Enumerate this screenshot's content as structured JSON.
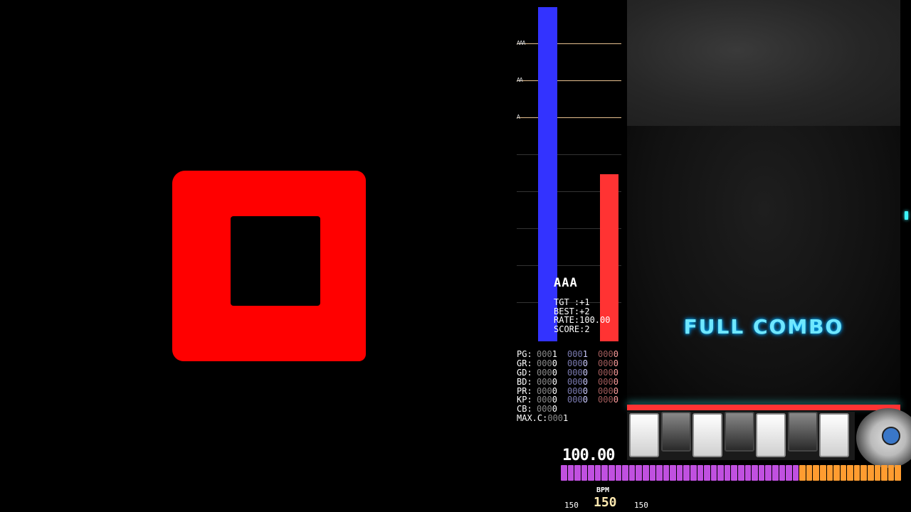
{
  "graph": {
    "grade_marks": [
      "AAA",
      "AA",
      "A"
    ],
    "current_fraction": 1.0,
    "target_fraction": 0.5
  },
  "rank": "AAA",
  "stats": {
    "tgt": "TGT :+1",
    "best": "BEST:+2",
    "rate": "RATE:100.00",
    "score": "SCORE:2"
  },
  "judge": [
    {
      "label": "PG:",
      "total": [
        "000",
        "1"
      ],
      "slow": [
        "000",
        "1"
      ],
      "fast": [
        "000",
        "0"
      ]
    },
    {
      "label": "GR:",
      "total": [
        "000",
        "0"
      ],
      "slow": [
        "000",
        "0"
      ],
      "fast": [
        "000",
        "0"
      ]
    },
    {
      "label": "GD:",
      "total": [
        "000",
        "0"
      ],
      "slow": [
        "000",
        "0"
      ],
      "fast": [
        "000",
        "0"
      ]
    },
    {
      "label": "BD:",
      "total": [
        "000",
        "0"
      ],
      "slow": [
        "000",
        "0"
      ],
      "fast": [
        "000",
        "0"
      ]
    },
    {
      "label": "PR:",
      "total": [
        "000",
        "0"
      ],
      "slow": [
        "000",
        "0"
      ],
      "fast": [
        "000",
        "0"
      ]
    },
    {
      "label": "KP:",
      "total": [
        "000",
        "0"
      ],
      "slow": [
        "000",
        "0"
      ],
      "fast": [
        "000",
        "0"
      ]
    },
    {
      "label": "CB:",
      "total": [
        "000",
        "0"
      ]
    }
  ],
  "max_combo": {
    "label": "MAX.C:",
    "value": [
      "000",
      "1"
    ]
  },
  "full_combo": "FULL COMBO",
  "gauge": {
    "value_text": "100.00",
    "fraction": 1.0
  },
  "bpm": {
    "label": "BPM",
    "now": "150",
    "min": "150",
    "max": "150"
  },
  "colors": {
    "bga_shape": "#ff0000",
    "current_bar": "#3333ff",
    "target_bar": "#ff3333",
    "full_combo": "#6fe7ff",
    "gauge_groove": "#c050e0",
    "gauge_clear": "#ff9c30"
  }
}
